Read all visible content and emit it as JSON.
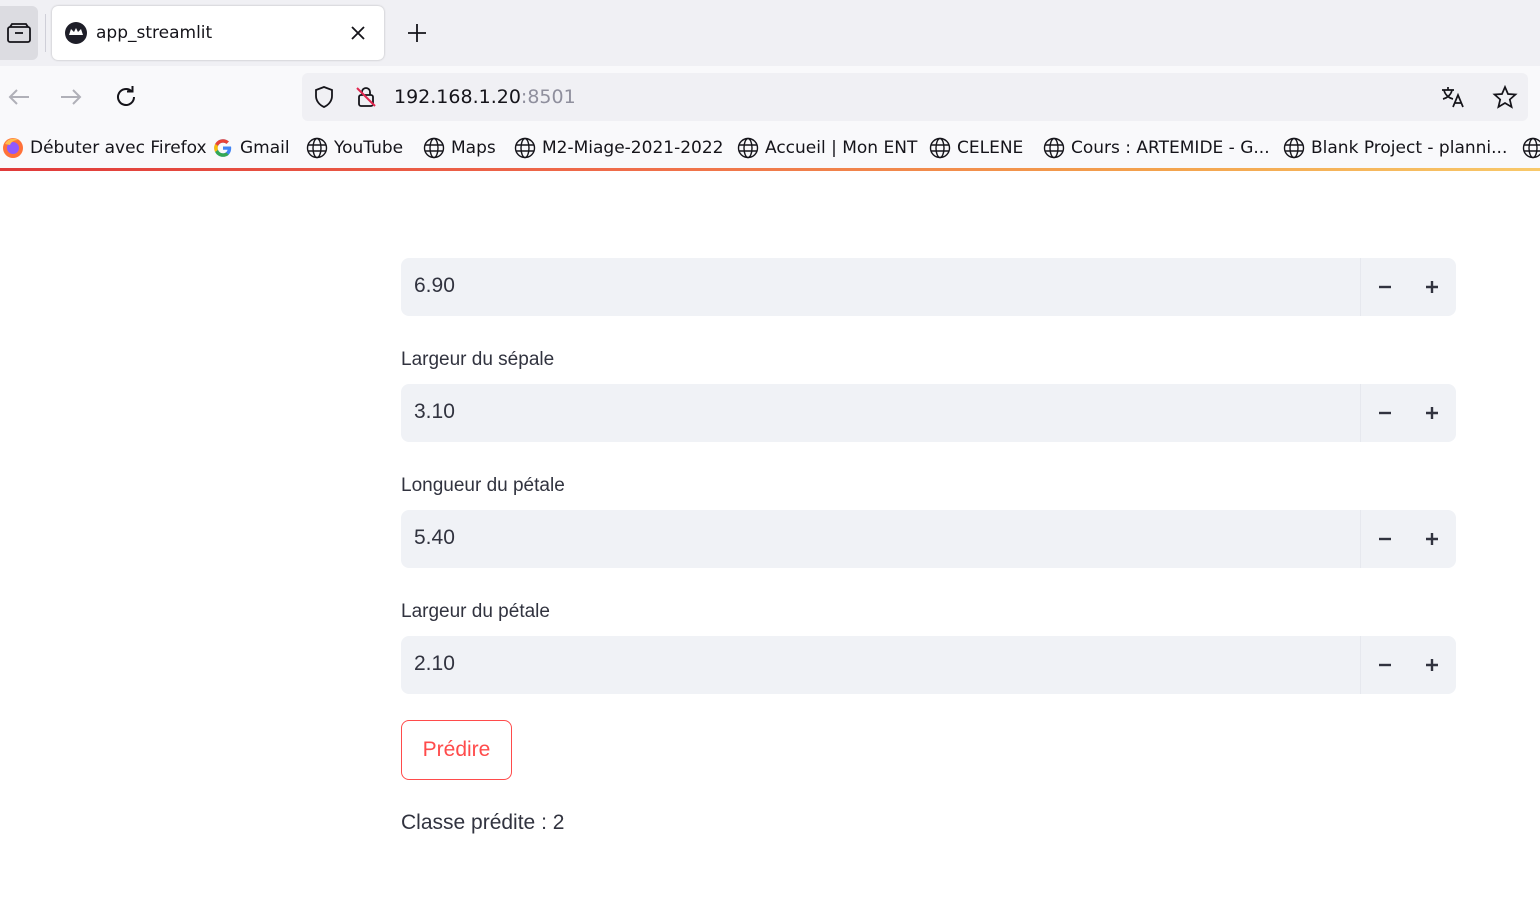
{
  "browser": {
    "tab": {
      "title": "app_streamlit",
      "favicon": "streamlit-crown-icon"
    },
    "url": {
      "host": "192.168.1.20",
      "port": ":8501"
    },
    "bookmarks": [
      {
        "label": "Débuter avec Firefox",
        "icon": "firefox-icon"
      },
      {
        "label": "Gmail",
        "icon": "google-icon"
      },
      {
        "label": "YouTube",
        "icon": "globe-icon"
      },
      {
        "label": "Maps",
        "icon": "globe-icon"
      },
      {
        "label": "M2-Miage-2021-2022",
        "icon": "globe-icon"
      },
      {
        "label": "Accueil | Mon ENT",
        "icon": "globe-icon"
      },
      {
        "label": "CELENE",
        "icon": "globe-icon"
      },
      {
        "label": "Cours : ARTEMIDE - G...",
        "icon": "globe-icon"
      },
      {
        "label": "Blank Project - planni...",
        "icon": "globe-icon"
      }
    ]
  },
  "app": {
    "fields": [
      {
        "label": "",
        "value": "6.90"
      },
      {
        "label": "Largeur du sépale",
        "value": "3.10"
      },
      {
        "label": "Longueur du pétale",
        "value": "5.40"
      },
      {
        "label": "Largeur du pétale",
        "value": "2.10"
      }
    ],
    "predict_button": "Prédire",
    "result": "Classe prédite : 2"
  },
  "colors": {
    "primary": "#ff4b4b",
    "input_bg": "#f0f2f6",
    "text": "#31333f"
  }
}
